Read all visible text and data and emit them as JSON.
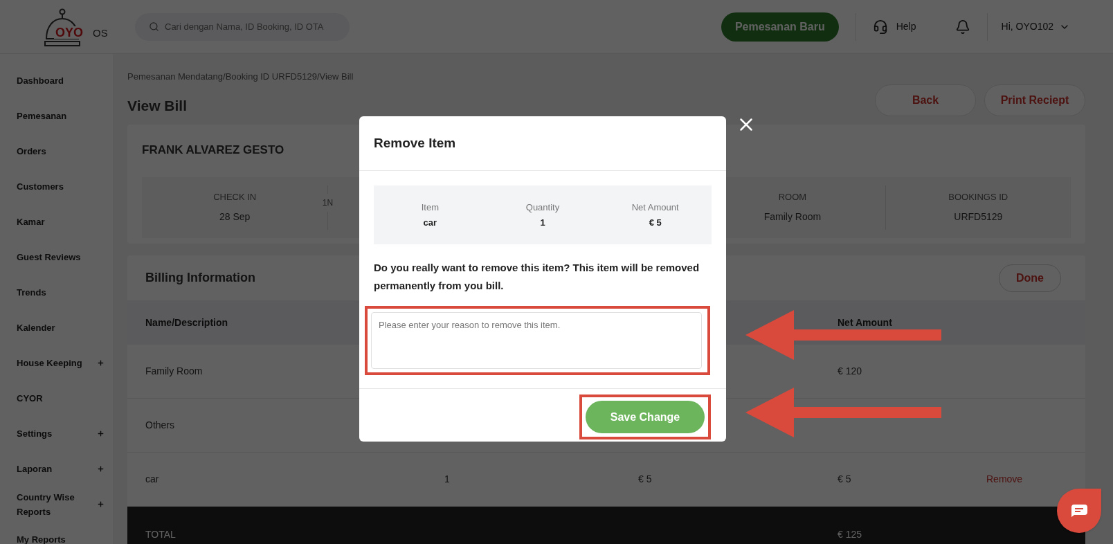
{
  "header": {
    "logo": {
      "brand": "OYO",
      "suffix": "OS"
    },
    "search": {
      "placeholder": "Cari dengan Nama, ID Booking, ID OTA"
    },
    "new_booking_button": "Pemesanan Baru",
    "help": "Help",
    "user_menu": "Hi, OYO102"
  },
  "sidebar": {
    "items": [
      {
        "label": "Dashboard",
        "expandable": false
      },
      {
        "label": "Pemesanan",
        "expandable": false
      },
      {
        "label": "Orders",
        "expandable": false
      },
      {
        "label": "Customers",
        "expandable": false
      },
      {
        "label": "Kamar",
        "expandable": false
      },
      {
        "label": "Guest Reviews",
        "expandable": false
      },
      {
        "label": "Trends",
        "expandable": false
      },
      {
        "label": "Kalender",
        "expandable": false
      },
      {
        "label": "House Keeping",
        "expandable": true
      },
      {
        "label": "CYOR",
        "expandable": false
      },
      {
        "label": "Settings",
        "expandable": true
      },
      {
        "label": "Laporan",
        "expandable": true
      },
      {
        "label": "Country Wise Reports",
        "expandable": true
      },
      {
        "label": "My Reports",
        "expandable": false
      }
    ]
  },
  "breadcrumb": "Pemesanan Mendatang/Booking ID URFD5129/View Bill",
  "page_title": "View Bill",
  "actions": [
    "Back",
    "Print Reciept"
  ],
  "guest": {
    "name": "FRANK ALVAREZ GESTO",
    "nights": "1N",
    "stats": [
      {
        "label": "CHECK IN",
        "value": "28 Sep"
      },
      {
        "label": "ROOM",
        "value": "Family Room"
      },
      {
        "label": "BOOKINGS ID",
        "value": "URFD5129"
      }
    ]
  },
  "billing": {
    "title": "Billing Information",
    "done_button": "Done",
    "columns": {
      "name": "Name/Description",
      "net": "Net Amount"
    },
    "rows": [
      {
        "name": "Family Room",
        "net": "€ 120"
      },
      {
        "name": "Others"
      },
      {
        "name": "car",
        "quantity": "1",
        "unit_price": "€ 5",
        "net": "€ 5",
        "action": "Remove"
      }
    ],
    "total": {
      "label": "TOTAL",
      "net": "€ 125"
    }
  },
  "modal": {
    "title": "Remove Item",
    "summary": [
      {
        "label": "Item",
        "value": "car"
      },
      {
        "label": "Quantity",
        "value": "1"
      },
      {
        "label": "Net Amount",
        "value": "€ 5"
      }
    ],
    "message": "Do you really want to remove this item? This item will be removed permanently from you bill.",
    "reason_field": {
      "placeholder": "Please enter your reason to remove this item."
    },
    "save_button": "Save Change"
  }
}
